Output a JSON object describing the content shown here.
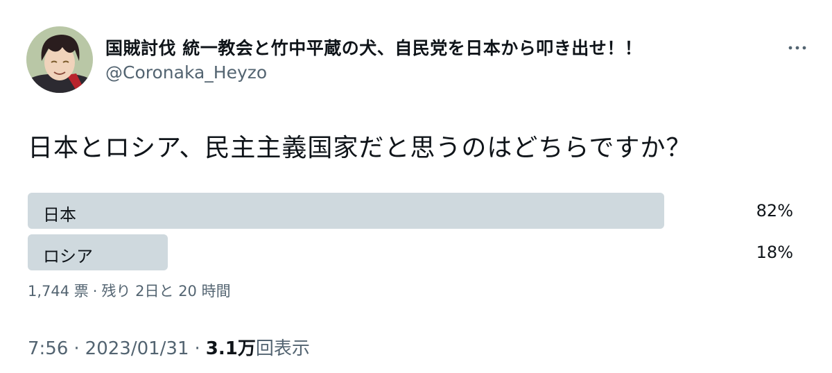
{
  "author": {
    "display_name": "国賊討伐 統一教会と竹中平蔵の犬、自民党を日本から叩き出せ！！",
    "handle": "@Coronaka_Heyzo",
    "avatar_icon": "user-avatar-icon"
  },
  "tweet": {
    "text": "日本とロシア、民主主義国家だと思うのはどちらですか？",
    "more_icon": "more-horizontal-icon"
  },
  "poll": {
    "options": [
      {
        "label": "日本",
        "percent_text": "82%",
        "fill": 0.82
      },
      {
        "label": "ロシア",
        "percent_text": "18%",
        "fill": 0.18
      }
    ],
    "votes": "1,744 票",
    "separator": "·",
    "remaining": "残り 2日と 20 時間"
  },
  "meta": {
    "time": "7:56",
    "separator": "·",
    "date": "2023/01/31",
    "views_count": "3.1万",
    "views_label": "回表示"
  },
  "colors": {
    "bar": "#cfd9de",
    "text": "#0f1419",
    "secondary": "#536471",
    "background": "#ffffff"
  }
}
